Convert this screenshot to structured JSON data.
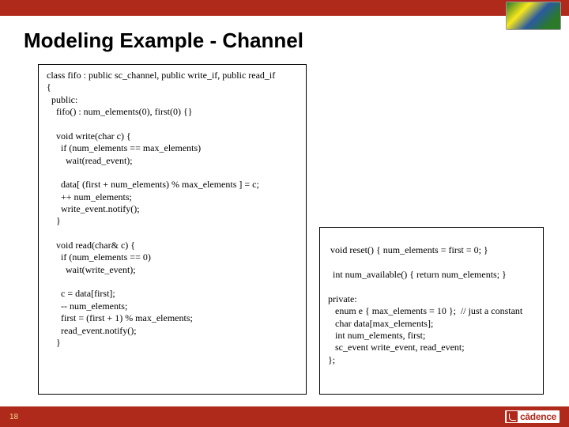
{
  "header": {
    "title": "Modeling Example - Channel"
  },
  "code": {
    "left": "class fifo : public sc_channel, public write_if, public read_if\n{\n  public:\n    fifo() : num_elements(0), first(0) {}\n\n    void write(char c) {\n      if (num_elements == max_elements)\n        wait(read_event);\n\n      data[ (first + num_elements) % max_elements ] = c;\n      ++ num_elements;\n      write_event.notify();\n    }\n\n    void read(char& c) {\n      if (num_elements == 0)\n        wait(write_event);\n\n      c = data[first];\n      -- num_elements;\n      first = (first + 1) % max_elements;\n      read_event.notify();\n    }",
    "right": "\n void reset() { num_elements = first = 0; }\n\n  int num_available() { return num_elements; }\n\nprivate:\n   enum e { max_elements = 10 };  // just a constant\n   char data[max_elements];\n   int num_elements, first;\n   sc_event write_event, read_event;\n};"
  },
  "footer": {
    "page": "18",
    "brand": "cādence"
  }
}
